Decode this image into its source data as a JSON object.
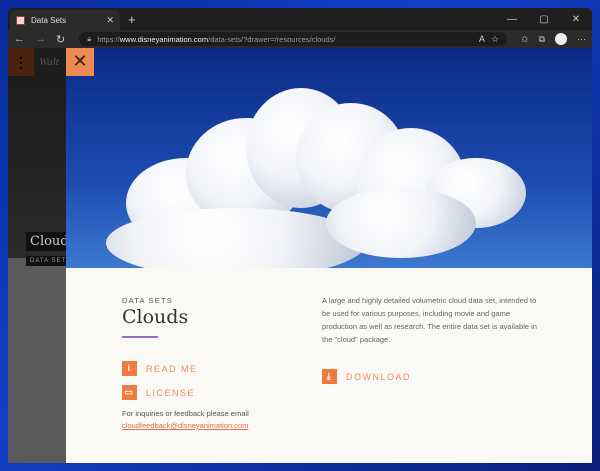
{
  "browser": {
    "tab_title": "Data Sets",
    "url_prefix": "https://",
    "url_domain": "www.disneyanimation.com",
    "url_path": "/data-sets/?drawer=/resources/clouds/"
  },
  "background_page": {
    "title": "Clouds",
    "tag": "DATA SETS",
    "logo": "Walt"
  },
  "drawer": {
    "kicker": "DATA SETS",
    "title": "Clouds",
    "readme_label": "READ ME",
    "license_label": "LICENSE",
    "inquiry_text": "For inquiries or feedback please email",
    "email": "cloudfeedback@disneyanimation.com",
    "description": "A large and highly detailed volumetric cloud data set, intended to be used for various purposes, including movie and game production as well as research. The entire data set is available in the \"cloud\" package.",
    "download_label": "DOWNLOAD"
  },
  "colors": {
    "accent": "#f07a40",
    "rule": "#9b6cc4",
    "sky": "#1c4bb0"
  }
}
